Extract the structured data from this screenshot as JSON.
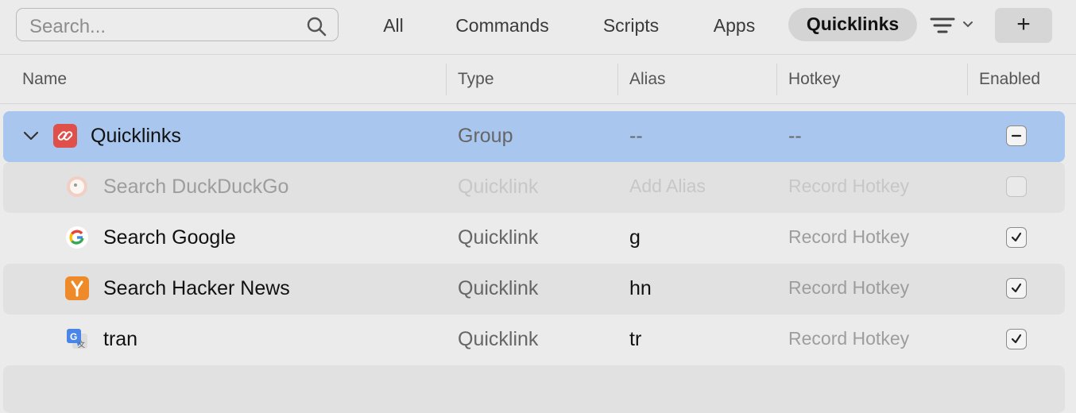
{
  "search": {
    "placeholder": "Search..."
  },
  "tabs": [
    "All",
    "Commands",
    "Scripts",
    "Apps",
    "Quicklinks"
  ],
  "active_tab": "Quicklinks",
  "add_label": "+",
  "columns": {
    "name": "Name",
    "type": "Type",
    "alias": "Alias",
    "hotkey": "Hotkey",
    "enabled": "Enabled"
  },
  "group": {
    "name": "Quicklinks",
    "type": "Group",
    "alias": "--",
    "hotkey": "--",
    "enabled": "mixed"
  },
  "rows": [
    {
      "name": "Search DuckDuckGo",
      "type": "Quicklink",
      "alias": "Add Alias",
      "hotkey": "Record Hotkey",
      "enabled": false,
      "icon": "duckduckgo-icon"
    },
    {
      "name": "Search Google",
      "type": "Quicklink",
      "alias": "g",
      "hotkey": "Record Hotkey",
      "enabled": true,
      "icon": "google-icon"
    },
    {
      "name": "Search Hacker News",
      "type": "Quicklink",
      "alias": "hn",
      "hotkey": "Record Hotkey",
      "enabled": true,
      "icon": "hacker-news-icon"
    },
    {
      "name": "tran",
      "type": "Quicklink",
      "alias": "tr",
      "hotkey": "Record Hotkey",
      "enabled": true,
      "icon": "google-translate-icon"
    }
  ],
  "colors": {
    "selection": "#a9c6ef",
    "quicklinks_icon": "#e0504a",
    "hacker_news": "#ef8a2b"
  }
}
